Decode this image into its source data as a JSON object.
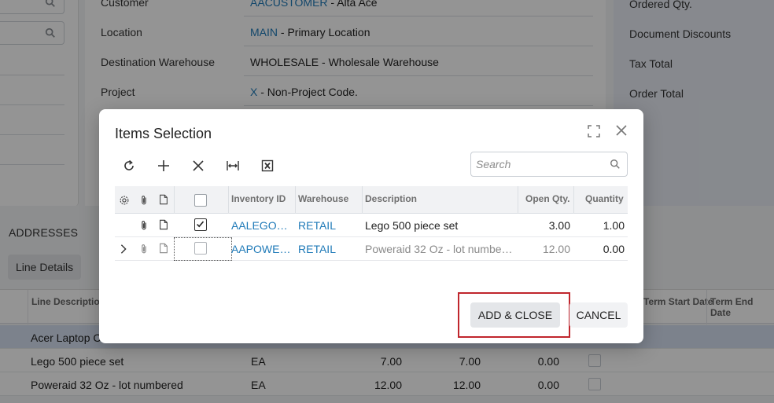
{
  "form": {
    "rows": [
      {
        "label": "Customer",
        "link": "AACUSTOMER",
        "value": " - Alta Ace"
      },
      {
        "label": "Location",
        "link": "MAIN",
        "value": " - Primary Location"
      },
      {
        "label": "Destination Warehouse",
        "link": "",
        "value": "WHOLESALE - Wholesale Warehouse"
      },
      {
        "label": "Project",
        "link": "X",
        "value": " - Non-Project Code."
      }
    ]
  },
  "summary": {
    "labels": [
      "Ordered Qty.",
      "Document Discounts",
      "Tax Total",
      "Order Total"
    ]
  },
  "sections": {
    "addresses": "ADDRESSES",
    "line_details_tab": "Line Details"
  },
  "main_grid": {
    "headers": [
      "Line Description",
      "Term Start Date",
      "Term End Date"
    ],
    "rows": [
      {
        "description": "Acer Laptop C",
        "uom": "",
        "qty1": "",
        "qty2": "",
        "qty3": ""
      },
      {
        "description": "Lego 500 piece set",
        "uom": "EA",
        "qty1": "7.00",
        "qty2": "7.00",
        "qty3": "0.00"
      },
      {
        "description": "Poweraid 32 Oz - lot numbered",
        "uom": "EA",
        "qty1": "12.00",
        "qty2": "12.00",
        "qty3": "0.00"
      }
    ]
  },
  "dialog": {
    "title": "Items Selection",
    "search_placeholder": "Search",
    "columns": {
      "inventory_id": "Inventory ID",
      "warehouse": "Warehouse",
      "description": "Description",
      "open_qty": "Open Qty.",
      "quantity": "Quantity"
    },
    "rows": [
      {
        "selected": true,
        "inventory_id": "AALEGO…",
        "warehouse": "RETAIL",
        "description": "Lego 500 piece set",
        "open_qty": "3.00",
        "quantity": "1.00"
      },
      {
        "selected": false,
        "inventory_id": "AAPOWE…",
        "warehouse": "RETAIL",
        "description": "Poweraid 32 Oz - lot numbe…",
        "open_qty": "12.00",
        "quantity": "0.00"
      }
    ],
    "add_close_label": "ADD & CLOSE",
    "cancel_label": "CANCEL"
  },
  "colors": {
    "link": "#1f7ab8",
    "highlight_outline": "#c0262d",
    "selected_row": "#d6e1f1"
  }
}
